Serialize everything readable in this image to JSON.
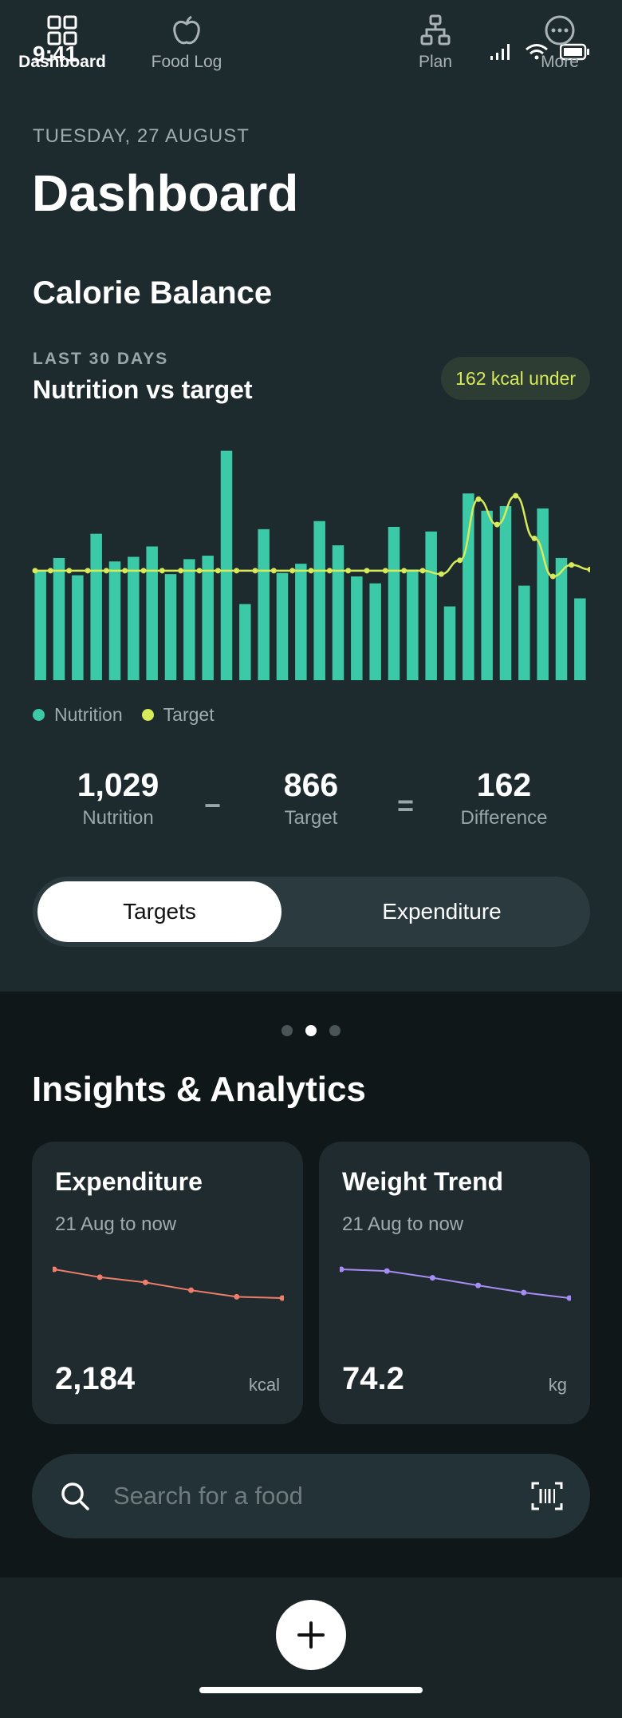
{
  "status": {
    "time": "9:41"
  },
  "header": {
    "date": "TUESDAY, 27 AUGUST",
    "title": "Dashboard"
  },
  "calorie_balance": {
    "section_title": "Calorie Balance",
    "range_label": "LAST 30 DAYS",
    "chart_title": "Nutrition vs target",
    "badge": "162 kcal under",
    "legend": [
      "Nutrition",
      "Target"
    ],
    "stats": {
      "nutrition": {
        "value": "1,029",
        "label": "Nutrition"
      },
      "target": {
        "value": "866",
        "label": "Target"
      },
      "difference": {
        "value": "162",
        "label": "Difference"
      },
      "minus": "−",
      "equals": "="
    },
    "segmented": {
      "options": [
        "Targets",
        "Expenditure"
      ],
      "selected": "Targets"
    }
  },
  "colors": {
    "nutrition": "#3cc9a7",
    "target": "#d7ea5a",
    "expenditure": "#ef7d6a",
    "weight": "#a78cf5",
    "background": "#0f1719",
    "panel": "#1d2a2e"
  },
  "chart_data": {
    "type": "bar",
    "series": [
      {
        "name": "Nutrition",
        "type": "bar",
        "values": [
          950,
          1060,
          910,
          1270,
          1030,
          1070,
          1160,
          920,
          1050,
          1080,
          1990,
          660,
          1310,
          930,
          1010,
          1380,
          1170,
          900,
          840,
          1330,
          960,
          1290,
          640,
          1620,
          1470,
          1510,
          820,
          1490,
          1060,
          710
        ]
      },
      {
        "name": "Target",
        "type": "line",
        "values": [
          950,
          950,
          950,
          950,
          950,
          950,
          950,
          950,
          950,
          950,
          950,
          950,
          950,
          950,
          950,
          950,
          950,
          950,
          950,
          950,
          950,
          950,
          920,
          1040,
          1570,
          1350,
          1600,
          1230,
          900,
          1000,
          960
        ]
      }
    ],
    "ylim": [
      0,
      2050
    ],
    "grid": false,
    "legend": "bottom-left"
  },
  "insights": {
    "title": "Insights & Analytics",
    "pager": {
      "count": 3,
      "active": 1
    },
    "cards": [
      {
        "title": "Expenditure",
        "subtitle": "21 Aug to now",
        "value": "2,184",
        "unit": "kcal",
        "trend": [
          2290,
          2260,
          2240,
          2210,
          2185,
          2180
        ]
      },
      {
        "title": "Weight Trend",
        "subtitle": "21 Aug to now",
        "value": "74.2",
        "unit": "kg",
        "trend": [
          75.0,
          74.96,
          74.8,
          74.62,
          74.45,
          74.32
        ]
      }
    ]
  },
  "search": {
    "placeholder": "Search for a food"
  },
  "tabs": [
    {
      "label": "Dashboard",
      "icon": "grid-icon",
      "active": true
    },
    {
      "label": "Food Log",
      "icon": "apple-icon",
      "active": false
    },
    {
      "label": "Add",
      "icon": "plus-icon",
      "active": false
    },
    {
      "label": "Plan",
      "icon": "hierarchy-icon",
      "active": false
    },
    {
      "label": "More",
      "icon": "more-icon",
      "active": false
    }
  ]
}
